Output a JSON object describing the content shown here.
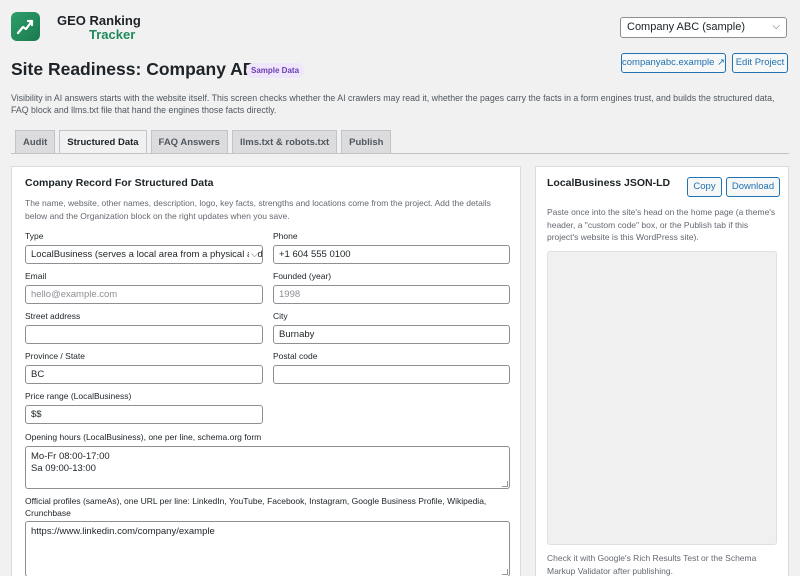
{
  "app": {
    "brand_line1": "GEO Ranking",
    "brand_line2": "Tracker",
    "logo_icon": "trend-up-icon",
    "accent": "#1f8a5b"
  },
  "header": {
    "project_select": "Company ABC (sample)",
    "site_link": "companyabc.example ↗",
    "edit_label": "Edit Project"
  },
  "page": {
    "title": "Site Readiness: Company ABC",
    "badge": "Sample Data",
    "intro": "Visibility in AI answers starts with the website itself. This screen checks whether the AI crawlers may read it, whether the pages carry the facts in a form engines trust, and builds the structured data, FAQ block and llms.txt file that hand the engines those facts directly."
  },
  "tabs": [
    {
      "label": "Audit"
    },
    {
      "label": "Structured Data",
      "active": true
    },
    {
      "label": "FAQ Answers"
    },
    {
      "label": "llms.txt & robots.txt"
    },
    {
      "label": "Publish"
    }
  ],
  "record": {
    "title": "Company Record For Structured Data",
    "desc": "The name, website, other names, description, logo, key facts, strengths and locations come from the project. Add the details below and the Organization block on the right updates when you save.",
    "type_label": "Type",
    "type_value": "LocalBusiness (serves a local area from a physical address)",
    "phone_label": "Phone",
    "phone_value": "+1 604 555 0100",
    "email_label": "Email",
    "email_placeholder": "hello@example.com",
    "founded_label": "Founded (year)",
    "founded_placeholder": "1998",
    "street_label": "Street address",
    "street_value": "",
    "city_label": "City",
    "city_value": "Burnaby",
    "province_label": "Province / State",
    "province_value": "BC",
    "postal_label": "Postal code",
    "postal_value": "",
    "price_label": "Price range (LocalBusiness)",
    "price_value": "$$",
    "hours_label": "Opening hours (LocalBusiness), one per line, schema.org form",
    "hours_lines": [
      "Mo-Fr 08:00-17:00",
      "Sa 09:00-13:00"
    ],
    "profiles_label": "Official profiles (sameAs), one URL per line: LinkedIn, YouTube, Facebook, Instagram, Google Business Profile, Wikipedia, Crunchbase",
    "profiles_value": "https://www.linkedin.com/company/example"
  },
  "jsonld": {
    "title": "LocalBusiness JSON-LD",
    "copy_label": "Copy",
    "download_label": "Download",
    "desc": "Paste once into the site's head on the home page (a theme's header, a \"custom code\" box, or the Publish tab if this project's website is this WordPress site).",
    "footer": "Check it with Google's Rich Results Test or the Schema Markup Validator after publishing."
  }
}
